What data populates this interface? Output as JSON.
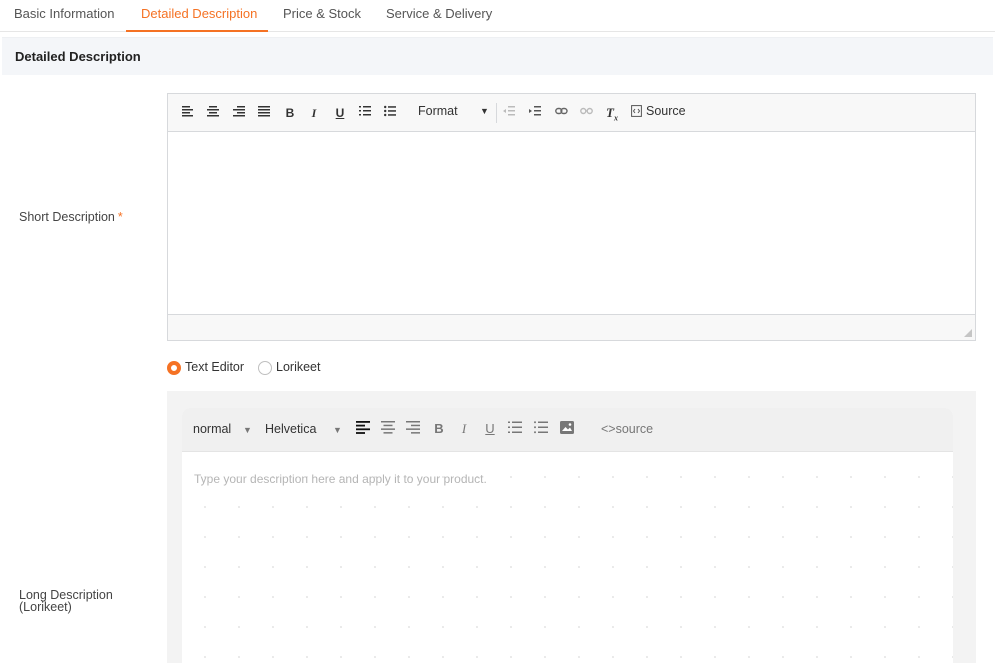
{
  "tabs": {
    "basic": "Basic Information",
    "detailed": "Detailed Description",
    "price": "Price & Stock",
    "service": "Service & Delivery"
  },
  "section": {
    "title": "Detailed Description"
  },
  "short_description": {
    "label": "Short Description",
    "required_mark": "*",
    "toolbar": {
      "format_label": "Format",
      "source_label": "Source",
      "icons": [
        "align-left-icon",
        "align-center-icon",
        "align-right-icon",
        "align-justify-icon",
        "bold-icon",
        "italic-icon",
        "underline-icon",
        "numbered-list-icon",
        "bulleted-list-icon",
        "outdent-icon",
        "indent-icon",
        "link-icon",
        "unlink-icon",
        "clear-format-icon",
        "source-icon"
      ]
    },
    "content": ""
  },
  "editor_mode": {
    "options": [
      "Text Editor",
      "Lorikeet"
    ],
    "selected": "Text Editor"
  },
  "long_description": {
    "label_line1": "Long Description",
    "label_line2": "(Lorikeet)",
    "toolbar": {
      "size_value": "normal",
      "font_value": "Helvetica",
      "source_label": "<>source"
    },
    "placeholder": "Type your description here and apply it to your product."
  },
  "colors": {
    "accent": "#f57224",
    "section_bg": "#f4f6f9",
    "border": "#d7d9dc"
  }
}
